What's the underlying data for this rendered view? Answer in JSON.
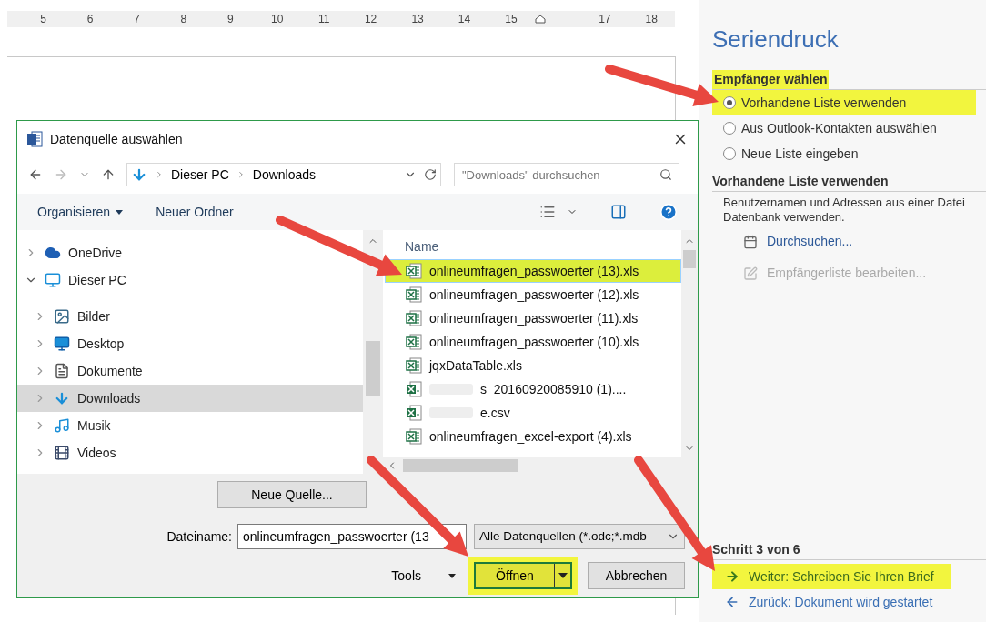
{
  "ruler": {
    "ticks": [
      {
        "kind": "number",
        "label": "5"
      },
      {
        "kind": "number",
        "label": "6"
      },
      {
        "kind": "number",
        "label": "7"
      },
      {
        "kind": "number",
        "label": "8"
      },
      {
        "kind": "number",
        "label": "9"
      },
      {
        "kind": "number",
        "label": "10"
      },
      {
        "kind": "number",
        "label": "11"
      },
      {
        "kind": "number",
        "label": "12"
      },
      {
        "kind": "number",
        "label": "13"
      },
      {
        "kind": "number",
        "label": "14"
      },
      {
        "kind": "number",
        "label": "15"
      },
      {
        "kind": "marker"
      },
      {
        "kind": "number",
        "label": "17"
      },
      {
        "kind": "number",
        "label": "18"
      }
    ]
  },
  "dialog": {
    "title": "Datenquelle auswählen",
    "address": {
      "crumbs": [
        "Dieser PC",
        "Downloads"
      ]
    },
    "search": {
      "placeholder": "\"Downloads\" durchsuchen"
    },
    "toolbar": {
      "organize": "Organisieren",
      "new_folder": "Neuer Ordner"
    },
    "nav": [
      {
        "label": "OneDrive",
        "kind": "cloud",
        "expanded": false,
        "selected": false
      },
      {
        "label": "Dieser PC",
        "kind": "pc",
        "expanded": true,
        "selected": false,
        "children": [
          {
            "label": "Bilder",
            "kind": "pictures",
            "expanded": false,
            "selected": false
          },
          {
            "label": "Desktop",
            "kind": "desktop",
            "expanded": false,
            "selected": false
          },
          {
            "label": "Dokumente",
            "kind": "documents",
            "expanded": false,
            "selected": false
          },
          {
            "label": "Downloads",
            "kind": "downloads",
            "expanded": false,
            "selected": true
          },
          {
            "label": "Musik",
            "kind": "music",
            "expanded": false,
            "selected": false
          },
          {
            "label": "Videos",
            "kind": "videos",
            "expanded": false,
            "selected": false
          }
        ]
      }
    ],
    "files": {
      "column": "Name",
      "rows": [
        {
          "name": "onlineumfragen_passwoerter (13).xls",
          "kind": "xls",
          "redacted": false,
          "selected": true,
          "highlighted": true
        },
        {
          "name": "onlineumfragen_passwoerter (12).xls",
          "kind": "xls",
          "redacted": false,
          "selected": false,
          "highlighted": false
        },
        {
          "name": "onlineumfragen_passwoerter (11).xls",
          "kind": "xls",
          "redacted": false,
          "selected": false,
          "highlighted": false
        },
        {
          "name": "onlineumfragen_passwoerter (10).xls",
          "kind": "xls",
          "redacted": false,
          "selected": false,
          "highlighted": false
        },
        {
          "name": "jqxDataTable.xls",
          "kind": "xls",
          "redacted": false,
          "selected": false,
          "highlighted": false
        },
        {
          "name": "s_20160920085910 (1)....",
          "kind": "csv",
          "redacted": true,
          "selected": false,
          "highlighted": false
        },
        {
          "name": "e.csv",
          "kind": "csv",
          "redacted": true,
          "selected": false,
          "highlighted": false
        },
        {
          "name": "onlineumfragen_excel-export (4).xls",
          "kind": "xls",
          "redacted": false,
          "selected": false,
          "highlighted": false
        }
      ]
    },
    "new_source": "Neue Quelle...",
    "filename_label": "Dateiname:",
    "filename": "onlineumfragen_passwoerter (13",
    "filter": "Alle Datenquellen (*.odc;*.mdb",
    "tools": "Tools",
    "open": {
      "label": "Öffnen",
      "highlighted": true
    },
    "cancel": "Abbrechen"
  },
  "pane": {
    "title": "Seriendruck",
    "recipients": {
      "heading": "Empfänger wählen",
      "highlighted": true,
      "options": [
        {
          "label": "Vorhandene Liste verwenden",
          "selected": true,
          "highlighted": true
        },
        {
          "label": "Aus Outlook-Kontakten auswählen",
          "selected": false,
          "highlighted": false
        },
        {
          "label": "Neue Liste eingeben",
          "selected": false,
          "highlighted": false
        }
      ]
    },
    "existing": {
      "heading": "Vorhandene Liste verwenden",
      "description": "Benutzernamen und Adressen aus einer Datei Datenbank verwenden.",
      "actions": [
        {
          "label": "Durchsuchen...",
          "kind": "browse",
          "disabled": false
        },
        {
          "label": "Empfängerliste bearbeiten...",
          "kind": "edit",
          "disabled": true
        }
      ]
    },
    "step": "Schritt 3 von 6",
    "next": {
      "label": "Weiter: Schreiben Sie Ihren Brief",
      "highlighted": true
    },
    "back": {
      "label": "Zurück: Dokument wird gestartet",
      "highlighted": false
    }
  }
}
